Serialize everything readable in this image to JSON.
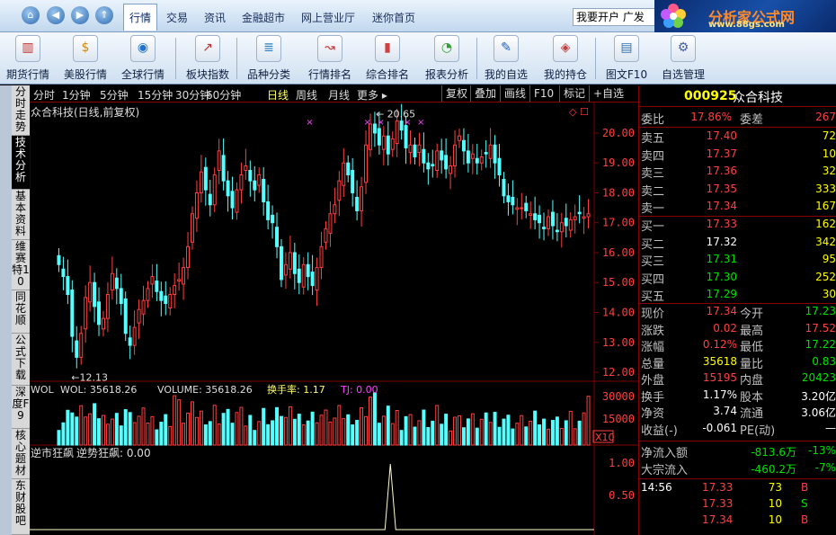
{
  "menubar": {
    "nav": [
      "⌂",
      "◀",
      "▶",
      "⇑"
    ],
    "items": [
      {
        "label": "行情",
        "active": true
      },
      {
        "label": "交易"
      },
      {
        "label": "资讯"
      },
      {
        "label": "金融超市"
      },
      {
        "label": "网上营业厅"
      },
      {
        "label": "迷你首页"
      }
    ],
    "open_account": "我要开户 广发"
  },
  "logo": {
    "title": "分析家公式网",
    "url": "www.88gs.com"
  },
  "toolbar": {
    "items": [
      {
        "label": "期货行情",
        "icon": "futures-icon",
        "glyph": "▥"
      },
      {
        "label": "美股行情",
        "icon": "us-stock-icon",
        "glyph": "$"
      },
      {
        "label": "全球行情",
        "icon": "globe-icon",
        "glyph": "◉"
      },
      {
        "label": "板块指数",
        "icon": "sector-index-icon",
        "glyph": "↗"
      },
      {
        "label": "品种分类",
        "icon": "category-icon",
        "glyph": "≣"
      },
      {
        "label": "行情排名",
        "icon": "ranking-icon",
        "glyph": "↝"
      },
      {
        "label": "综合排名",
        "icon": "composite-rank-icon",
        "glyph": "▮"
      },
      {
        "label": "报表分析",
        "icon": "report-icon",
        "glyph": "◔"
      },
      {
        "label": "我的自选",
        "icon": "watchlist-icon",
        "glyph": "✎"
      },
      {
        "label": "我的持仓",
        "icon": "holdings-icon",
        "glyph": "◈"
      },
      {
        "label": "图文F10",
        "icon": "f10-icon",
        "glyph": "▤"
      },
      {
        "label": "自选管理",
        "icon": "manage-icon",
        "glyph": "⚙"
      }
    ]
  },
  "vtabs": [
    "分时走势",
    "技术分析",
    "基本资料",
    "维赛特10",
    "同花顺",
    "公式下载",
    "深度F9",
    "核心题材",
    "东财股吧"
  ],
  "periods": [
    "分时",
    "1分钟",
    "5分钟",
    "15分钟",
    "30分钟",
    "60分钟",
    "日线",
    "周线",
    "月线",
    "更多 ▸"
  ],
  "period_active": "日线",
  "period_buttons": [
    "复权",
    "叠加",
    "画线",
    "F10",
    "标记",
    "+自选"
  ],
  "chart": {
    "title": "众合科技(日线,前复权)",
    "price_ticks": [
      "20.00",
      "19.00",
      "18.00",
      "17.00",
      "16.00",
      "15.00",
      "14.00",
      "13.00",
      "12.00"
    ],
    "high_label": "20.65",
    "low_label": "12.13",
    "vol_header": {
      "name": "WOL",
      "wol": "WOL: 35618.26",
      "volume": "VOLUME: 35618.26",
      "turnover": "换手率: 1.17",
      "tj": "TJ: 0.00"
    },
    "vol_ticks": [
      "30000",
      "15000"
    ],
    "vol_unit": "X10",
    "ind_header": {
      "name": "逆市狂飙",
      "value": "逆势狂飙: 0.00"
    },
    "ind_ticks": [
      "1.00",
      "0.50"
    ],
    "colors": {
      "up": "#ff4040",
      "down": "#54ffff",
      "grid": "#800000"
    }
  },
  "chart_data": {
    "type": "candlestick",
    "price_range": [
      11.7,
      20.9
    ],
    "volume_max": 40000,
    "candles": []
  },
  "quote": {
    "code": "000925",
    "name": "众合科技",
    "weibi_label": "委比",
    "weibi": "17.86%",
    "weicha_label": "委差",
    "weicha": "267",
    "sell": [
      {
        "label": "卖五",
        "price": "17.40",
        "vol": "72"
      },
      {
        "label": "卖四",
        "price": "17.37",
        "vol": "10"
      },
      {
        "label": "卖三",
        "price": "17.36",
        "vol": "32"
      },
      {
        "label": "卖二",
        "price": "17.35",
        "vol": "333"
      },
      {
        "label": "卖一",
        "price": "17.34",
        "vol": "167"
      }
    ],
    "buy": [
      {
        "label": "买一",
        "price": "17.33",
        "vol": "162"
      },
      {
        "label": "买二",
        "price": "17.32",
        "vol": "342"
      },
      {
        "label": "买三",
        "price": "17.31",
        "vol": "95"
      },
      {
        "label": "买四",
        "price": "17.30",
        "vol": "252"
      },
      {
        "label": "买五",
        "price": "17.29",
        "vol": "30"
      }
    ],
    "stats": [
      {
        "l1": "现价",
        "v1": "17.34",
        "c1": "red",
        "l2": "今开",
        "v2": "17.23",
        "c2": "grn"
      },
      {
        "l1": "涨跌",
        "v1": "0.02",
        "c1": "red",
        "l2": "最高",
        "v2": "17.52",
        "c2": "red"
      },
      {
        "l1": "涨幅",
        "v1": "0.12%",
        "c1": "red",
        "l2": "最低",
        "v2": "17.22",
        "c2": "grn"
      },
      {
        "l1": "总量",
        "v1": "35618",
        "c1": "yel",
        "l2": "量比",
        "v2": "0.83",
        "c2": "grn"
      },
      {
        "l1": "外盘",
        "v1": "15195",
        "c1": "red",
        "l2": "内盘",
        "v2": "20423",
        "c2": "grn"
      },
      {
        "l1": "换手",
        "v1": "1.17%",
        "c1": "wht",
        "l2": "股本",
        "v2": "3.20亿",
        "c2": "wht"
      },
      {
        "l1": "净资",
        "v1": "3.74",
        "c1": "wht",
        "l2": "流通",
        "v2": "3.06亿",
        "c2": "wht"
      },
      {
        "l1": "收益(-)",
        "v1": "-0.061",
        "c1": "wht",
        "l2": "PE(动)",
        "v2": "—",
        "c2": "wht"
      }
    ],
    "flows": [
      {
        "label": "净流入额",
        "value": "-813.6万",
        "pct": "-13%"
      },
      {
        "label": "大宗流入",
        "value": "-460.2万",
        "pct": "-7%"
      }
    ],
    "ticks": [
      {
        "time": "14:56",
        "price": "17.33",
        "vol": "73",
        "side": "B"
      },
      {
        "time": "",
        "price": "17.33",
        "vol": "10",
        "side": "S"
      },
      {
        "time": "",
        "price": "17.34",
        "vol": "10",
        "side": "B"
      }
    ]
  }
}
